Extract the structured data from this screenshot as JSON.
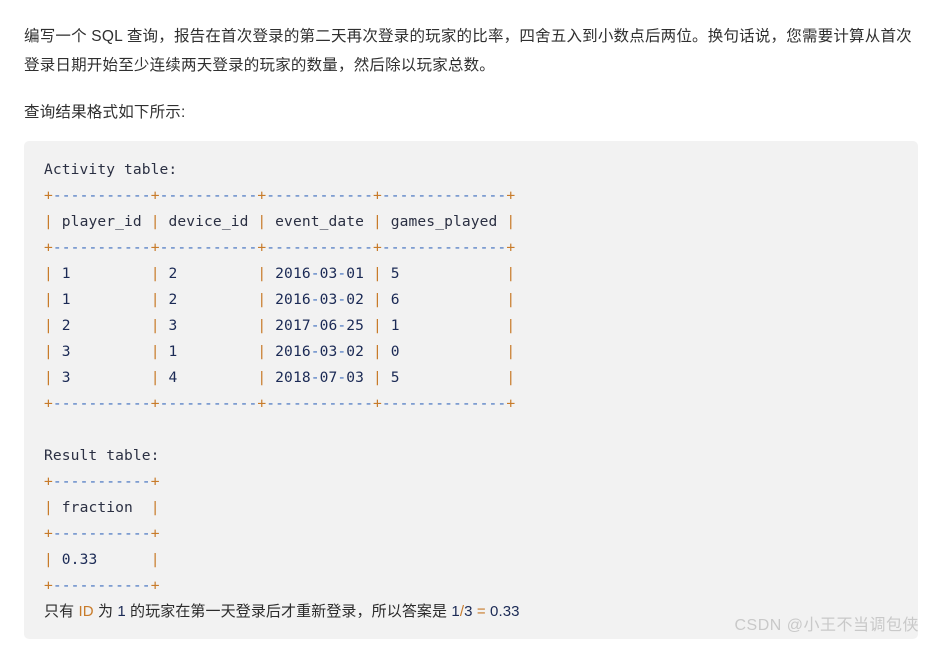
{
  "document": {
    "intro_paragraph": "编写一个 SQL 查询，报告在首次登录的第二天再次登录的玩家的比率，四舍五入到小数点后两位。换句话说，您需要计算从首次登录日期开始至少连续两天登录的玩家的数量，然后除以玩家总数。",
    "format_paragraph": "查询结果格式如下所示:"
  },
  "code_block": {
    "activity_title": "Activity table:",
    "activity_separator": "+-----------+-----------+------------+--------------+",
    "activity_header": "| player_id | device_id | event_date | games_played |",
    "activity_rows": [
      "| 1         | 2         | 2016-03-01 | 5            |",
      "| 1         | 2         | 2016-03-02 | 6            |",
      "| 2         | 3         | 2017-06-25 | 1            |",
      "| 3         | 1         | 2016-03-02 | 0            |",
      "| 3         | 4         | 2018-07-03 | 5            |"
    ],
    "result_title": "Result table:",
    "result_separator": "+-----------+",
    "result_header": "| fraction  |",
    "result_rows": [
      "| 0.33      |"
    ],
    "explanation": "只有 ID 为 1 的玩家在第一天登录后才重新登录，所以答案是 1/3 = 0.33"
  },
  "watermark": {
    "text": "CSDN @小王不当调包侠"
  },
  "colors": {
    "page_background": "#ffffff",
    "code_background": "#f2f2f2",
    "body_text": "#2f2f2f",
    "code_text": "#1c2340",
    "pipe_accent": "#c87b2a",
    "dash_accent": "#3f6fbf",
    "watermark": "#c9c9c9"
  },
  "table_data": {
    "type": "table",
    "activity_table": {
      "name": "Activity",
      "columns": [
        "player_id",
        "device_id",
        "event_date",
        "games_played"
      ],
      "rows": [
        [
          1,
          2,
          "2016-03-01",
          5
        ],
        [
          1,
          2,
          "2016-03-02",
          6
        ],
        [
          2,
          3,
          "2017-06-25",
          1
        ],
        [
          3,
          1,
          "2016-03-02",
          0
        ],
        [
          3,
          4,
          "2018-07-03",
          5
        ]
      ]
    },
    "result_table": {
      "name": "Result",
      "columns": [
        "fraction"
      ],
      "rows": [
        [
          0.33
        ]
      ]
    }
  }
}
